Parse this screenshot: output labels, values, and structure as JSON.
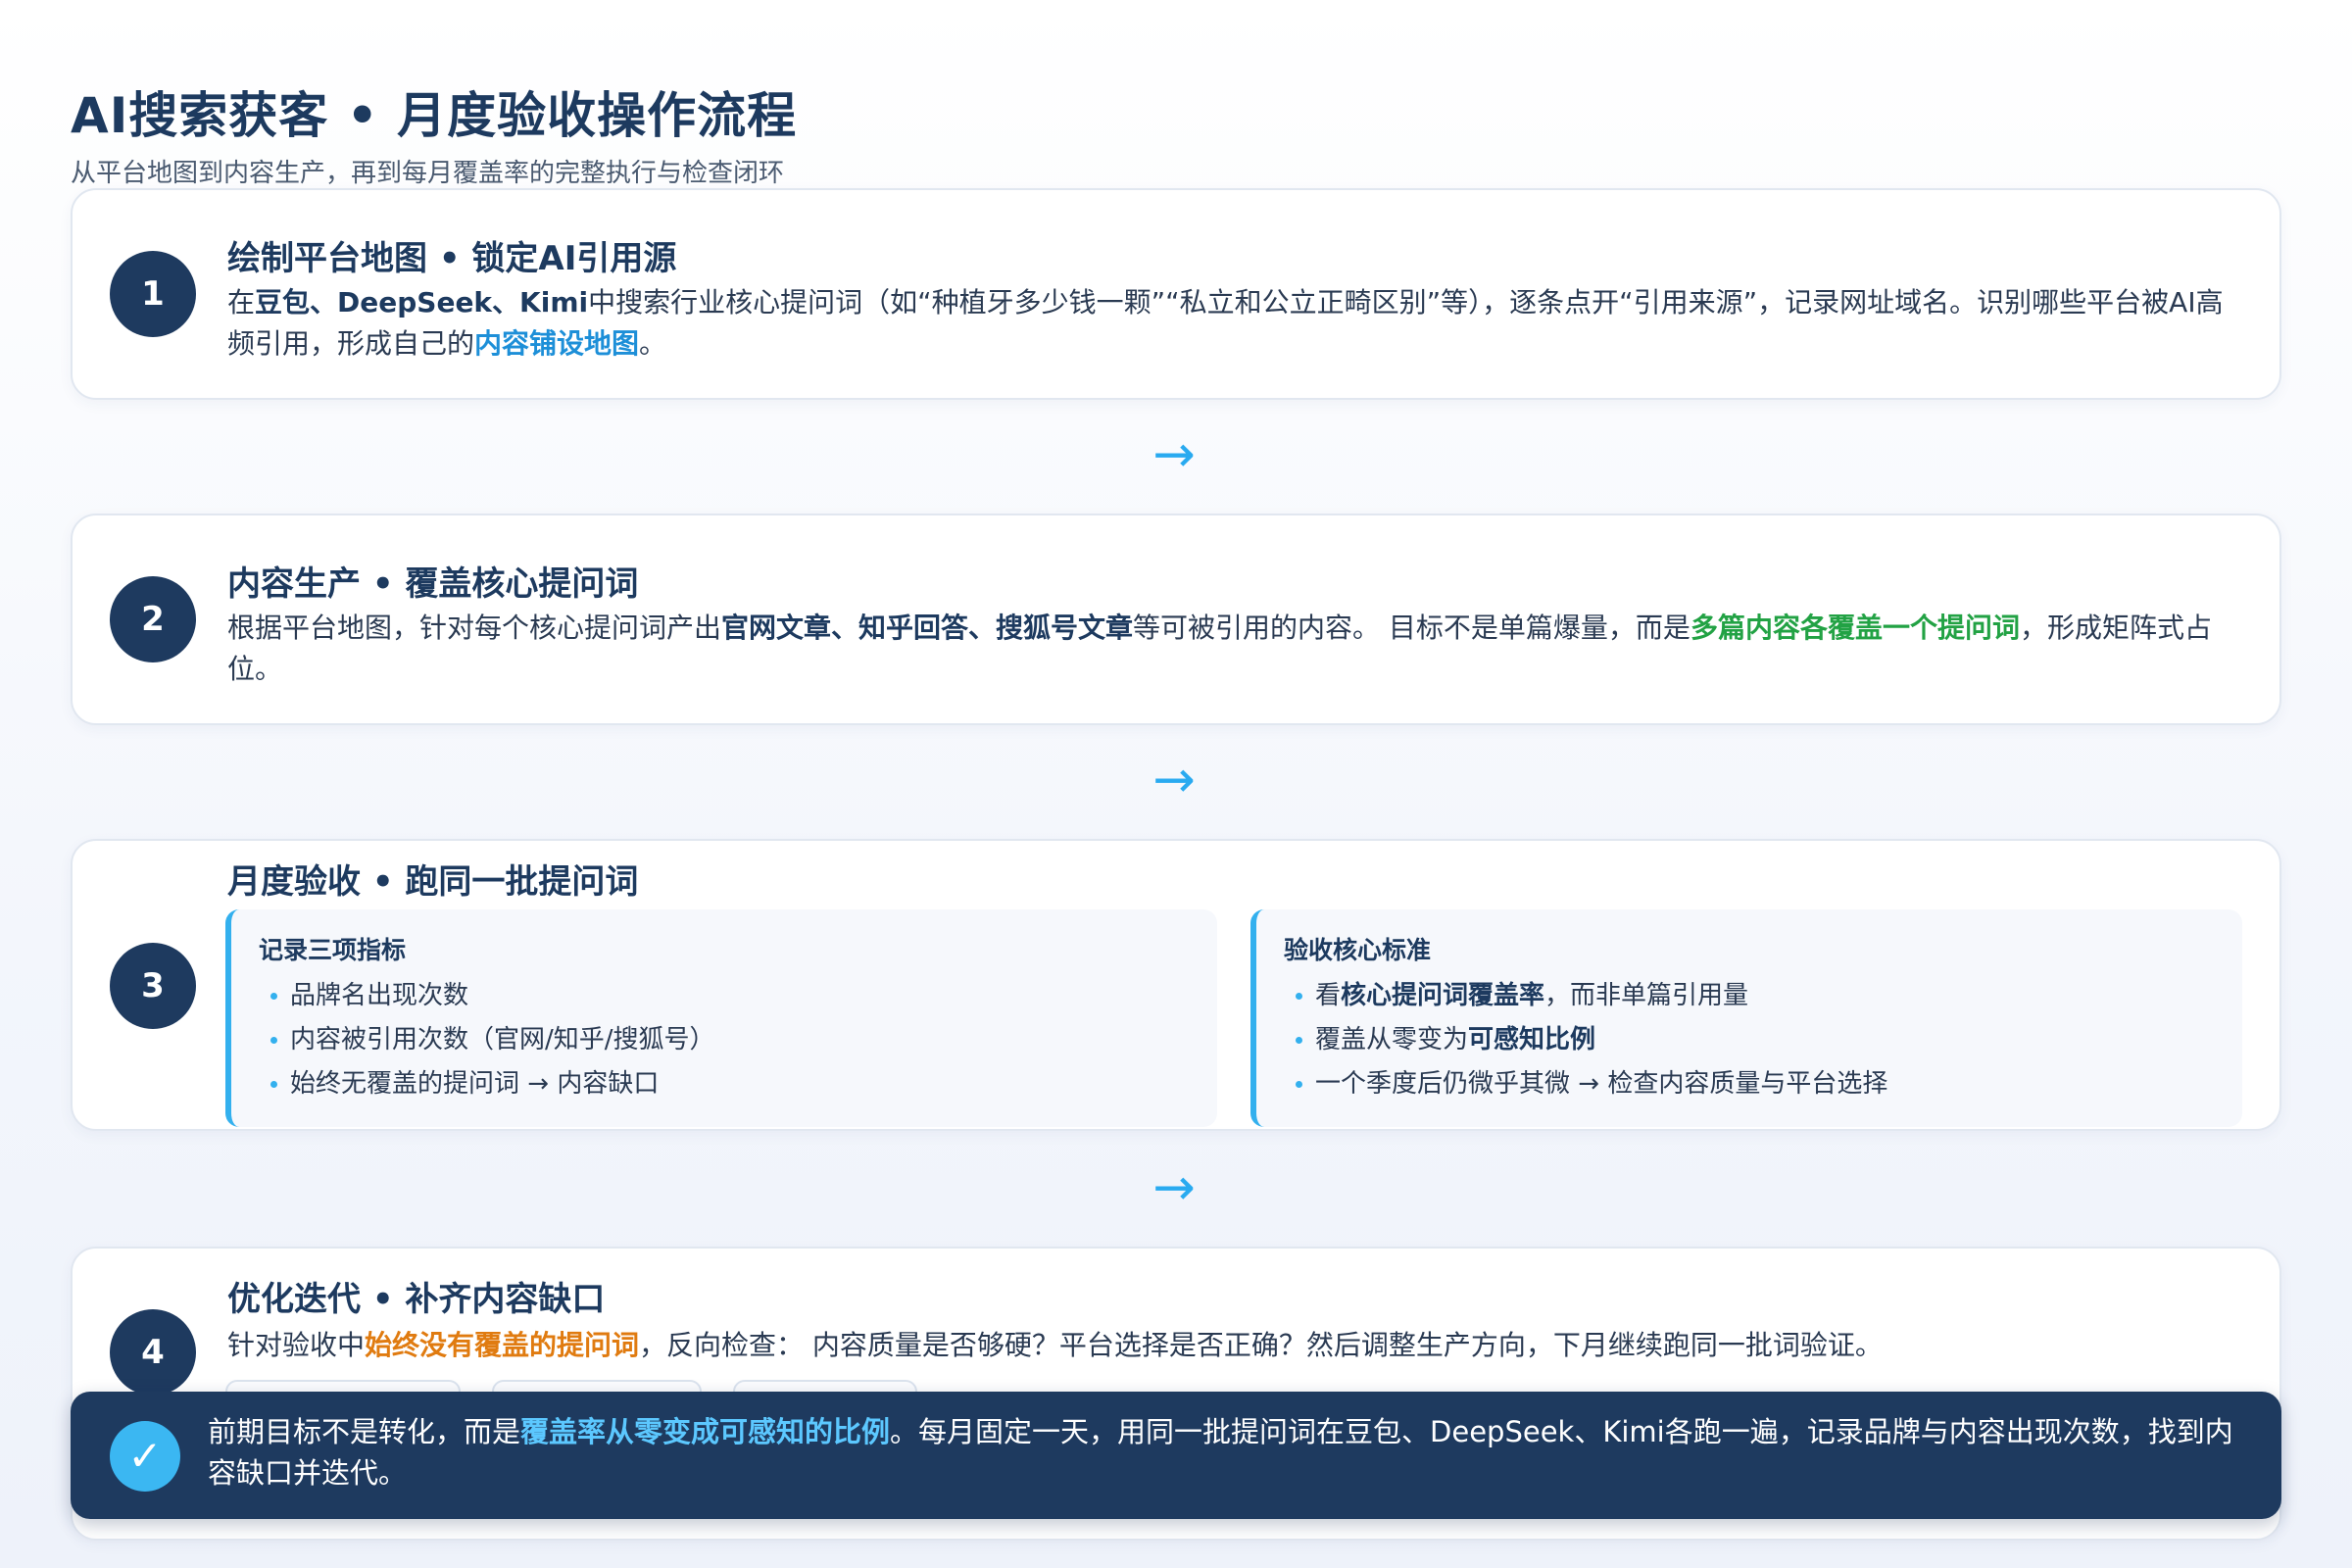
{
  "header": {
    "title": "AI搜索获客 • 月度验收操作流程",
    "subtitle": "从平台地图到内容生产，再到每月覆盖率的完整执行与检查闭环"
  },
  "steps": [
    {
      "number": "1",
      "title": "绘制平台地图 • 锁定AI引用源",
      "body": {
        "t1": "在",
        "b1": "豆包、DeepSeek、Kimi",
        "t2": "中搜索行业核心提问词（如“种植牙多少钱一颗”“私立和公立正畸区别”等），逐条点开“引用来源”，记录网址域名。识别哪些平台被AI高频引用，形成自己的",
        "h1": "内容铺设地图",
        "t3": "。"
      }
    },
    {
      "number": "2",
      "title": "内容生产 • 覆盖核心提问词",
      "body": {
        "t1": "根据平台地图，针对每个核心提问词产出",
        "b1": "官网文章、知乎回答、搜狐号文章",
        "t2": "等可被引用的内容。 目标不是单篇爆量，而是",
        "h1": "多篇内容各覆盖一个提问词",
        "t3": "，形成矩阵式占位。"
      }
    },
    {
      "number": "3",
      "title": "月度验收 • 跑同一批提问词",
      "panels": [
        {
          "title": "记录三项指标",
          "items": [
            {
              "pre": "品牌名出现次数",
              "bold": "",
              "post": ""
            },
            {
              "pre": "内容被引用次数（官网/知乎/搜狐号）",
              "bold": "",
              "post": ""
            },
            {
              "pre": "始终无覆盖的提问词 → 内容缺口",
              "bold": "",
              "post": ""
            }
          ]
        },
        {
          "title": "验收核心标准",
          "items": [
            {
              "pre": "看",
              "bold": "核心提问词覆盖率",
              "post": "，而非单篇引用量"
            },
            {
              "pre": "覆盖从零变为",
              "bold": "可感知比例",
              "post": ""
            },
            {
              "pre": "一个季度后仍微乎其微 → 检查内容质量与平台选择",
              "bold": "",
              "post": ""
            }
          ]
        }
      ]
    },
    {
      "number": "4",
      "title": "优化迭代 • 补齐内容缺口",
      "body": {
        "t1": "针对验收中",
        "h1": "始终没有覆盖的提问词",
        "t2": "，反向检查： 内容质量是否够硬？平台选择是否正确？然后调整生产方向，下月继续跑同一批词验证。"
      }
    }
  ],
  "flow_arrow": "→",
  "banner": {
    "check_glyph": "✓",
    "t1": "前期目标不是转化，而是",
    "h1": "覆盖率从零变成可感知的比例",
    "t2": "。每月固定一天，用同一批提问词在豆包、DeepSeek、Kimi各跑一遍，记录品牌与内容出现次数，找到内容缺口并迭代。"
  },
  "colors": {
    "navy": "#1e3a5f",
    "accent_blue": "#1d8fd8",
    "highlight_green": "#22a244",
    "highlight_orange": "#e07b10",
    "arrow_cyan": "#29aaf0"
  },
  "icons": {
    "step_badge": "number-circle",
    "flow_arrow": "arrow-right-icon",
    "banner_check": "check-circle-icon",
    "list_bullet": "dot-bullet"
  }
}
